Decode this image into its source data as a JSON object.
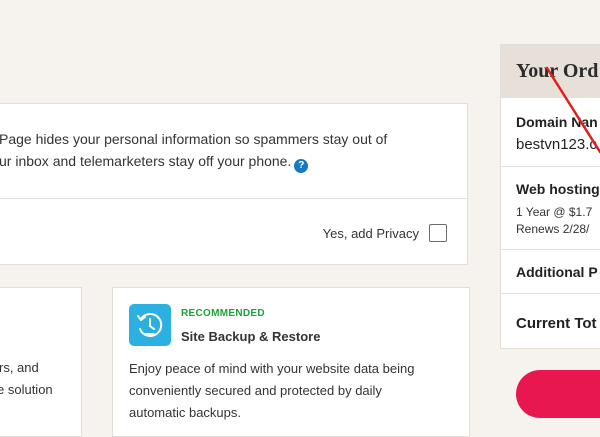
{
  "privacy": {
    "line1": "Page hides your personal information so spammers stay out of",
    "line2": "ur inbox and telemarketers stay off your phone.",
    "help_glyph": "?",
    "option_label": "Yes, add Privacy"
  },
  "addons": {
    "left_fragment_1": "rs, and",
    "left_fragment_2": "e solution",
    "right": {
      "badge": "RECOMMENDED",
      "title": "Site Backup & Restore",
      "desc_line1": "Enjoy peace of mind with your website data being",
      "desc_line2": "conveniently secured and protected by daily",
      "desc_line3": "automatic backups."
    }
  },
  "order": {
    "title": "Your Ord",
    "domain_label": "Domain Nan",
    "domain_value": "bestvn123.c",
    "hosting_label": "Web hosting",
    "hosting_term": "1 Year @ $1.7",
    "hosting_renew": "Renews 2/28/",
    "additional_label": "Additional P",
    "total_label": "Current Tot"
  },
  "colors": {
    "accent_pink": "#e8174f",
    "recommended_green": "#1fa03c",
    "backup_icon_blue": "#2cb0e1",
    "help_blue": "#1779c2",
    "annotation_red": "#e0201c"
  },
  "icons": {
    "help": "help-circle-icon",
    "backup": "backup-restore-clock-icon"
  }
}
